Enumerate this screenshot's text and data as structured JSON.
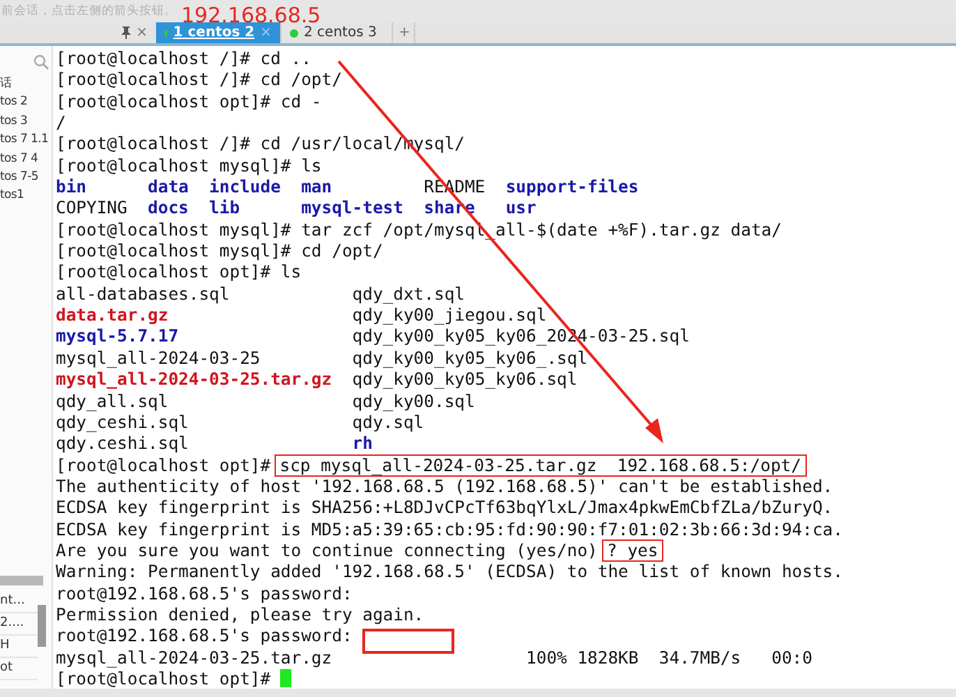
{
  "info_bar": {
    "text": "前会话，点击左侧的箭头按钮。"
  },
  "panel_header": {
    "close": "×"
  },
  "tabs": [
    {
      "label": "1 centos 2",
      "selected": true,
      "close": "×"
    },
    {
      "label": "2 centos 3",
      "selected": false
    },
    {
      "label": "+",
      "selected": false
    }
  ],
  "sidebar": {
    "items": [
      "话",
      "tos 2",
      "tos 3",
      "tos 7 1.1",
      "tos 7 4",
      "tos 7-5",
      "tos1"
    ],
    "lower_items": [
      "nt...",
      "2....",
      "H",
      "ot"
    ]
  },
  "terminal": {
    "lines": [
      {
        "kind": "text",
        "segments": [
          {
            "text": "[root@localhost /]# cd ..",
            "kind": "plain"
          }
        ]
      },
      {
        "kind": "text",
        "segments": [
          {
            "text": "[root@localhost /]# cd /opt/",
            "kind": "plain"
          }
        ]
      },
      {
        "kind": "text",
        "segments": [
          {
            "text": "[root@localhost opt]# cd -",
            "kind": "plain"
          }
        ]
      },
      {
        "kind": "text",
        "segments": [
          {
            "text": "/",
            "kind": "plain"
          }
        ]
      },
      {
        "kind": "text",
        "segments": [
          {
            "text": "[root@localhost /]# cd /usr/local/mysql/",
            "kind": "plain"
          }
        ]
      },
      {
        "kind": "text",
        "segments": [
          {
            "text": "[root@localhost mysql]# ls",
            "kind": "plain"
          }
        ]
      },
      {
        "kind": "ls",
        "cells": [
          {
            "text": "bin",
            "kind": "dir"
          },
          {
            "text": "data",
            "kind": "dir"
          },
          {
            "text": "include",
            "kind": "dir"
          },
          {
            "text": "man",
            "kind": "dir"
          },
          {
            "text": "README",
            "kind": "plain"
          },
          {
            "text": "support-files",
            "kind": "dir"
          }
        ]
      },
      {
        "kind": "ls",
        "cells": [
          {
            "text": "COPYING",
            "kind": "plain"
          },
          {
            "text": "docs",
            "kind": "dir"
          },
          {
            "text": "lib",
            "kind": "dir"
          },
          {
            "text": "mysql-test",
            "kind": "dir"
          },
          {
            "text": "share",
            "kind": "dir"
          },
          {
            "text": "usr",
            "kind": "dir"
          }
        ]
      },
      {
        "kind": "text",
        "segments": [
          {
            "text": "[root@localhost mysql]# tar zcf /opt/mysql_all-$(date +%F).tar.gz data/",
            "kind": "plain"
          }
        ]
      },
      {
        "kind": "text",
        "segments": [
          {
            "text": "[root@localhost mysql]# cd /opt/",
            "kind": "plain"
          }
        ]
      },
      {
        "kind": "text",
        "segments": [
          {
            "text": "[root@localhost opt]# ls",
            "kind": "plain"
          }
        ]
      },
      {
        "kind": "ls",
        "cells": [
          {
            "text": "all-databases.sql",
            "kind": "plain"
          },
          {
            "text": "qdy_dxt.sql",
            "kind": "plain"
          }
        ]
      },
      {
        "kind": "ls",
        "cells": [
          {
            "text": "data.tar.gz",
            "kind": "archive"
          },
          {
            "text": "qdy_ky00_jiegou.sql",
            "kind": "plain"
          }
        ]
      },
      {
        "kind": "ls",
        "cells": [
          {
            "text": "mysql-5.7.17",
            "kind": "dir"
          },
          {
            "text": "qdy_ky00_ky05_ky06_2024-03-25.sql",
            "kind": "plain"
          }
        ]
      },
      {
        "kind": "ls",
        "cells": [
          {
            "text": "mysql_all-2024-03-25",
            "kind": "plain"
          },
          {
            "text": "qdy_ky00_ky05_ky06_.sql",
            "kind": "plain"
          }
        ]
      },
      {
        "kind": "ls",
        "cells": [
          {
            "text": "mysql_all-2024-03-25.tar.gz",
            "kind": "archive"
          },
          {
            "text": "qdy_ky00_ky05_ky06.sql",
            "kind": "plain"
          }
        ]
      },
      {
        "kind": "ls",
        "cells": [
          {
            "text": "qdy_all.sql",
            "kind": "plain"
          },
          {
            "text": "qdy_ky00.sql",
            "kind": "plain"
          }
        ]
      },
      {
        "kind": "ls",
        "cells": [
          {
            "text": "qdy_ceshi.sql",
            "kind": "plain"
          },
          {
            "text": "qdy.sql",
            "kind": "plain"
          }
        ]
      },
      {
        "kind": "ls",
        "cells": [
          {
            "text": "qdy.ceshi.sql",
            "kind": "plain"
          },
          {
            "text": "rh",
            "kind": "dir"
          }
        ]
      },
      {
        "kind": "text",
        "segments": [
          {
            "text": "[root@localhost opt]#",
            "kind": "plain"
          },
          {
            "text": "scp mysql_all-2024-03-25.tar.gz  192.168.68.5:/opt/",
            "kind": "boxed"
          }
        ]
      },
      {
        "kind": "text",
        "segments": [
          {
            "text": "The authenticity of host '192.168.68.5 (192.168.68.5)' can't be established.",
            "kind": "plain"
          }
        ]
      },
      {
        "kind": "text",
        "segments": [
          {
            "text": "ECDSA key fingerprint is SHA256:+L8DJvCPcTf63bqYlxL/Jmax4pkwEmCbfZLa/bZuryQ.",
            "kind": "plain"
          }
        ]
      },
      {
        "kind": "text",
        "segments": [
          {
            "text": "ECDSA key fingerprint is MD5:a5:39:65:cb:95:fd:90:90:f7:01:02:3b:66:3d:94:ca.",
            "kind": "plain"
          }
        ]
      },
      {
        "kind": "text",
        "segments": [
          {
            "text": "Are you sure you want to continue connecting (yes/no)",
            "kind": "plain"
          },
          {
            "text": "? yes",
            "kind": "boxed"
          }
        ]
      },
      {
        "kind": "text",
        "segments": [
          {
            "text": "Warning: Permanently added '192.168.68.5' (ECDSA) to the list of known hosts.",
            "kind": "plain"
          }
        ]
      },
      {
        "kind": "text",
        "segments": [
          {
            "text": "root@192.168.68.5's password:",
            "kind": "plain"
          }
        ]
      },
      {
        "kind": "text",
        "segments": [
          {
            "text": "Permission denied, please try again.",
            "kind": "plain"
          }
        ]
      },
      {
        "kind": "text",
        "segments": [
          {
            "text": "root@192.168.68.5's password:",
            "kind": "plain"
          }
        ]
      },
      {
        "kind": "text",
        "segments": [
          {
            "text": "mysql_all-2024-03-25.tar.gz                   100% 1828KB  34.7MB/s   00:0",
            "kind": "plain"
          }
        ]
      },
      {
        "kind": "text",
        "segments": [
          {
            "text": "[root@localhost opt]#",
            "kind": "plain"
          },
          {
            "kind": "cursor"
          }
        ]
      }
    ]
  },
  "annotation": {
    "label": "192.168.68.5"
  }
}
